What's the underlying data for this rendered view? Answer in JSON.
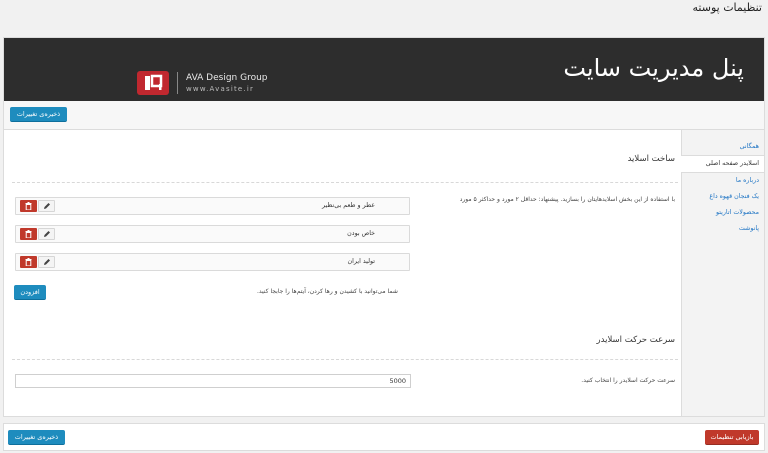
{
  "page": {
    "title": "تنظیمات پوسته"
  },
  "header": {
    "title": "پنل مدیریت سایت",
    "brand_name": "AVA Design Group",
    "brand_url": "www.Avasite.ir",
    "brand_logo_icon": "ava-logo-icon"
  },
  "toolbar": {
    "save_label": "ذخیره‌ی تغییرات"
  },
  "sidebar": {
    "items": [
      {
        "label": "همگانی"
      },
      {
        "label": "اسلایدر صفحه اصلی"
      },
      {
        "label": "درباره ما"
      },
      {
        "label": "یک فنجان قهوه داغ"
      },
      {
        "label": "محصولات اتاریتو"
      },
      {
        "label": "پانوشت"
      }
    ]
  },
  "slider_section": {
    "title": "ساخت اسلاید",
    "description": "با استفاده از این بخش اسلایدهایتان را بسازید. پیشنهاد: حداقل ۲ مورد و حداکثر ۵ مورد",
    "slides": [
      {
        "label": "عطر و طعم بی‌نظیر"
      },
      {
        "label": "خاص بودن"
      },
      {
        "label": "تولید ایران"
      }
    ],
    "add_label": "افزودن",
    "drag_hint": "شما می‌توانید با کشیدن و رها کردن، آیتم‌ها را جابجا کنید."
  },
  "speed_section": {
    "title": "سرعت حرکت اسلایدر",
    "description": "سرعت حرکت اسلایدر را انتخاب کنید.",
    "value": "5000"
  },
  "footer": {
    "reset_label": "بازیابی تنظیمات",
    "save_label": "ذخیره‌ی تغییرات"
  },
  "colors": {
    "header_bg": "#2d2d2d",
    "primary_blue": "#1e8cbe",
    "danger_red": "#c0392b",
    "link_blue": "#1e74c4"
  }
}
